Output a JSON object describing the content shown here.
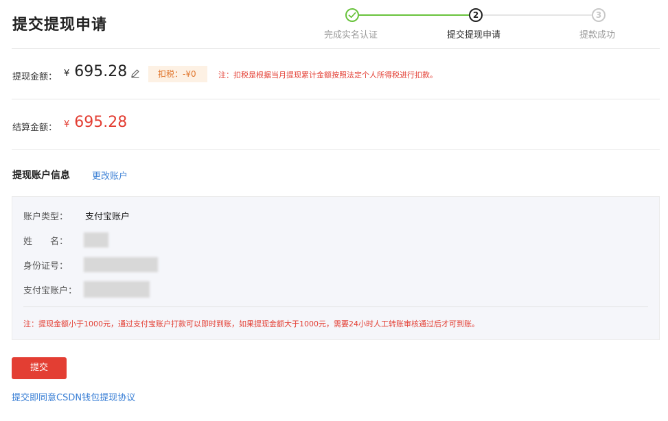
{
  "page": {
    "title": "提交提现申请"
  },
  "stepper": {
    "steps": [
      {
        "label": "完成实名认证",
        "status": "done",
        "number": "✓"
      },
      {
        "label": "提交提现申请",
        "status": "active",
        "number": "2"
      },
      {
        "label": "提款成功",
        "status": "todo",
        "number": "3"
      }
    ]
  },
  "withdraw": {
    "label": "提现金额：",
    "currency": "¥",
    "amount": "695.28",
    "tax_badge": "扣税：-¥0",
    "tax_note": "注：扣税是根据当月提现累计金额按照法定个人所得税进行扣款。"
  },
  "settlement": {
    "label": "结算金额：",
    "currency": "¥",
    "amount": "695.28"
  },
  "account": {
    "section_title": "提现账户信息",
    "change_link": "更改账户",
    "fields": [
      {
        "label": "账户类型：",
        "value": "支付宝账户"
      },
      {
        "label": "姓　　名：",
        "value": ""
      },
      {
        "label": "身份证号：",
        "value": ""
      },
      {
        "label": "支付宝账户：",
        "value": ""
      }
    ],
    "note": "注：提现金额小于1000元，通过支付宝账户打款可以即时到账，如果提现金额大于1000元，需要24小时人工转账审核通过后才可到账。"
  },
  "actions": {
    "submit_label": "提交",
    "agreement_link": "提交即同意CSDN钱包提现协议"
  },
  "colors": {
    "accent_red": "#e33e33",
    "link_blue": "#3a7fd5",
    "step_done_green": "#67c23a",
    "tax_badge_bg": "#fdf1e4"
  }
}
